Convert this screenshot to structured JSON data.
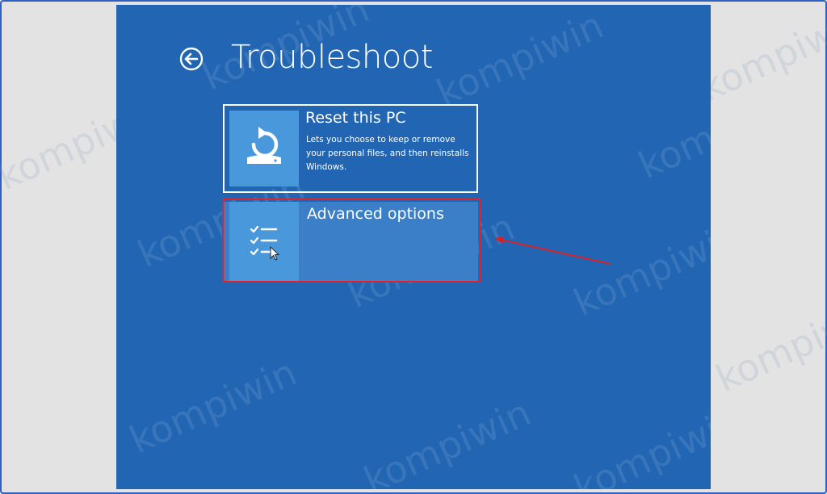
{
  "page": {
    "title": "Troubleshoot"
  },
  "options": [
    {
      "title": "Reset this PC",
      "description": "Lets you choose to keep or remove your personal files, and then reinstalls Windows.",
      "icon": "reset-pc-icon"
    },
    {
      "title": "Advanced options",
      "description": "",
      "icon": "checklist-icon",
      "highlighted": true
    }
  ],
  "watermark": {
    "text": "kompiwin"
  },
  "colors": {
    "screen_bg": "#2266b3",
    "tile_bg": "#4a98dc",
    "selected_bg": "#3b7fc8",
    "highlight": "#e0222a",
    "frame": "#2f5fbf"
  }
}
